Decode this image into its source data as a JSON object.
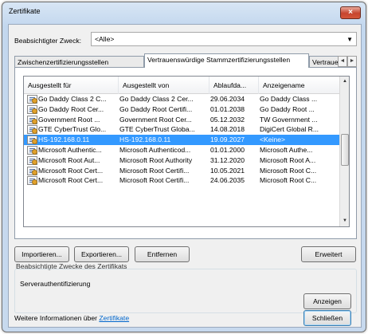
{
  "window": {
    "title": "Zertifikate",
    "close_glyph": "×"
  },
  "purpose": {
    "label": "Beabsichtigter Zweck:",
    "value": "<Alle>"
  },
  "tabs": [
    {
      "label": "Zwischenzertifizierungsstellen"
    },
    {
      "label": "Vertrauenswürdige Stammzertifizierungsstellen"
    },
    {
      "label": "Vertrauens"
    }
  ],
  "tab_scroll": {
    "left": "◄",
    "right": "►"
  },
  "list": {
    "columns": [
      "Ausgestellt für",
      "Ausgestellt von",
      "Ablaufda...",
      "Anzeigename"
    ],
    "selected_index": 5,
    "rows": [
      [
        "Go Daddy Class 2 C...",
        "Go Daddy Class 2 Cer...",
        "29.06.2034",
        "Go Daddy Class ..."
      ],
      [
        "Go Daddy Root Cer...",
        "Go Daddy Root Certifi...",
        "01.01.2038",
        "Go Daddy Root ..."
      ],
      [
        "Government Root ...",
        "Government Root Cer...",
        "05.12.2032",
        "TW Government ..."
      ],
      [
        "GTE CyberTrust Glo...",
        "GTE CyberTrust Globa...",
        "14.08.2018",
        "DigiCert Global R..."
      ],
      [
        "HS-192.168.0.11",
        "HS-192.168.0.11",
        "19.09.2027",
        "<Keine>"
      ],
      [
        "Microsoft Authentic...",
        "Microsoft Authenticod...",
        "01.01.2000",
        "Microsoft Authe..."
      ],
      [
        "Microsoft Root Aut...",
        "Microsoft Root Authority",
        "31.12.2020",
        "Microsoft Root A..."
      ],
      [
        "Microsoft Root Cert...",
        "Microsoft Root Certifi...",
        "10.05.2021",
        "Microsoft Root C..."
      ],
      [
        "Microsoft Root Cert...",
        "Microsoft Root Certifi...",
        "24.06.2035",
        "Microsoft Root C..."
      ]
    ]
  },
  "buttons": {
    "import": "Importieren...",
    "export": "Exportieren...",
    "remove": "Entfernen",
    "advanced": "Erweitert",
    "view": "Anzeigen",
    "close": "Schließen"
  },
  "purposes_group": {
    "label": "Beabsichtigte Zwecke des Zertifikats",
    "value": "Serverauthentifizierung"
  },
  "info": {
    "prefix": "Weitere Informationen über ",
    "link": "Zertifikate"
  },
  "colors": {
    "selection": "#3399ff",
    "link": "#0066cc"
  }
}
